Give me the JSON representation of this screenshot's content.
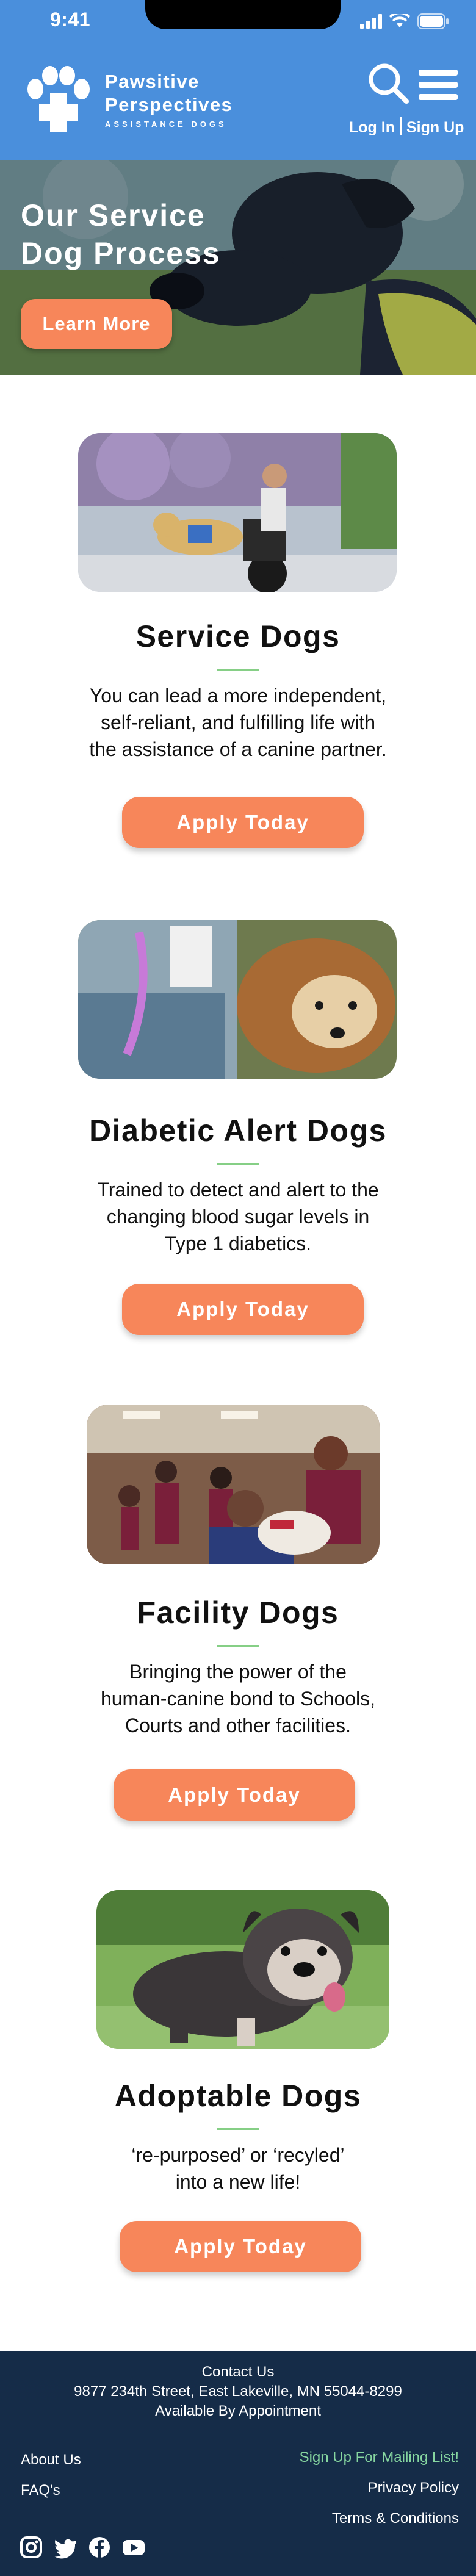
{
  "status_bar": {
    "time": "9:41"
  },
  "header": {
    "brand_line1": "Pawsitive",
    "brand_line2": "Perspectives",
    "brand_line3": "ASSISTANCE DOGS",
    "login": "Log In",
    "signup": "Sign Up",
    "colors": {
      "header_bg": "#4a8fdc",
      "accent": "#f7865a"
    }
  },
  "hero": {
    "title": "Our Service\nDog Process",
    "button": "Learn More"
  },
  "cards": [
    {
      "title": "Service Dogs",
      "description": "You can lead a more independent,\nself-reliant, and fulfilling life with\nthe assistance of a canine partner.",
      "button": "Apply Today"
    },
    {
      "title": "Diabetic Alert Dogs",
      "description": "Trained to detect and alert to the\nchanging blood sugar levels in\nType 1 diabetics.",
      "button": "Apply Today"
    },
    {
      "title": "Facility Dogs",
      "description": "Bringing the power of the\nhuman-canine bond to Schools,\nCourts and other facilities.",
      "button": "Apply Today"
    },
    {
      "title": "Adoptable Dogs",
      "description": "‘re-purposed’ or ‘recyled’\ninto a new life!",
      "button": "Apply Today"
    }
  ],
  "footer": {
    "contact_heading": "Contact Us",
    "address": "9877 234th Street, East Lakeville, MN 55044-8299",
    "appointment": "Available By Appointment",
    "about": "About Us",
    "faq": "FAQ's",
    "mailing": "Sign Up For Mailing List!",
    "privacy": "Privacy Policy",
    "terms": "Terms & Conditions",
    "social_icons": [
      "instagram-icon",
      "twitter-icon",
      "facebook-icon",
      "youtube-icon"
    ],
    "colors": {
      "footer_bg": "#152c48",
      "mailing_link": "#86d6a0"
    }
  }
}
